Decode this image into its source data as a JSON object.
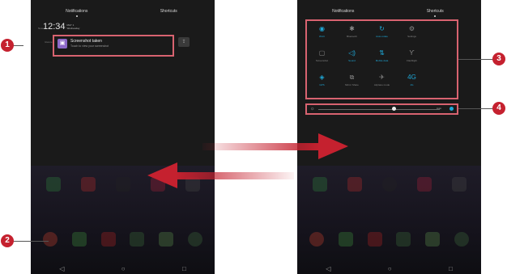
{
  "tabs": {
    "notifications": "Notifications",
    "shortcuts": "Shortcuts"
  },
  "left": {
    "clock": {
      "time": "12:34",
      "date_line1": "MAY 1",
      "date_line2": "Wednesday",
      "side_label": "Now 1"
    },
    "notification": {
      "title": "Screenshot taken",
      "body": "Touch to view your screenshot",
      "icon": "image-icon",
      "side_label": "Glance"
    },
    "share_icon": "share-icon"
  },
  "right": {
    "tiles": [
      {
        "label": "Wi-Fi",
        "icon": "wifi-icon",
        "on": true
      },
      {
        "label": "Bluetooth",
        "icon": "bluetooth-icon",
        "on": false
      },
      {
        "label": "Auto-rotate",
        "icon": "rotate-icon",
        "on": true
      },
      {
        "label": "Settings",
        "icon": "gear-icon",
        "on": false
      },
      {
        "label": "",
        "icon": "",
        "on": false
      },
      {
        "label": "Screenshot",
        "icon": "screenshot-icon",
        "on": false
      },
      {
        "label": "Sound",
        "icon": "sound-icon",
        "on": true
      },
      {
        "label": "Mobile data",
        "icon": "mobile-data-icon",
        "on": true
      },
      {
        "label": "Flashlight",
        "icon": "flashlight-icon",
        "on": false
      },
      {
        "label": "",
        "icon": "",
        "on": false
      },
      {
        "label": "GPS",
        "icon": "location-icon",
        "on": true
      },
      {
        "label": "Mirror Share",
        "icon": "mirror-icon",
        "on": false
      },
      {
        "label": "Airplane mode",
        "icon": "airplane-icon",
        "on": false
      },
      {
        "label": "4G",
        "icon": "4g-icon",
        "on": true
      },
      {
        "label": "",
        "icon": "",
        "on": false
      }
    ],
    "brightness": {
      "level_fraction": 0.62,
      "auto_label": "Auto"
    }
  },
  "navbar": {
    "back": "◁",
    "home": "○",
    "recent": "□"
  },
  "callouts": [
    "1",
    "2",
    "3",
    "4"
  ],
  "colors": {
    "accent": "#1fa8d8",
    "highlight": "#d86370",
    "callout": "#c5212f",
    "arrow": "#c5212f"
  }
}
